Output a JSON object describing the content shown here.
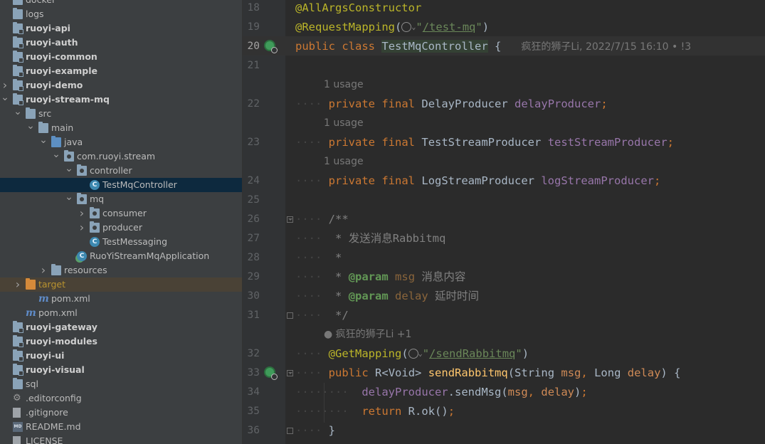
{
  "project_tree": [
    {
      "label": "docker",
      "depth": 0,
      "arrow": "none",
      "icon": "folder",
      "bold": false
    },
    {
      "label": "logs",
      "depth": 0,
      "arrow": "none",
      "icon": "folder",
      "bold": false
    },
    {
      "label": "ruoyi-api",
      "depth": 0,
      "arrow": "none",
      "icon": "module-folder",
      "bold": true
    },
    {
      "label": "ruoyi-auth",
      "depth": 0,
      "arrow": "none",
      "icon": "module-folder",
      "bold": true
    },
    {
      "label": "ruoyi-common",
      "depth": 0,
      "arrow": "none",
      "icon": "module-folder",
      "bold": true
    },
    {
      "label": "ruoyi-example",
      "depth": 0,
      "arrow": "none",
      "icon": "module-folder",
      "bold": true
    },
    {
      "label": "ruoyi-demo",
      "depth": 0,
      "arrow": "right",
      "icon": "module-folder",
      "bold": true
    },
    {
      "label": "ruoyi-stream-mq",
      "depth": 0,
      "arrow": "down",
      "icon": "module-folder",
      "bold": true
    },
    {
      "label": "src",
      "depth": 1,
      "arrow": "down",
      "icon": "folder",
      "bold": false
    },
    {
      "label": "main",
      "depth": 2,
      "arrow": "down",
      "icon": "folder",
      "bold": false
    },
    {
      "label": "java",
      "depth": 3,
      "arrow": "down",
      "icon": "source-folder",
      "bold": false
    },
    {
      "label": "com.ruoyi.stream",
      "depth": 4,
      "arrow": "down",
      "icon": "package",
      "bold": false
    },
    {
      "label": "controller",
      "depth": 5,
      "arrow": "down",
      "icon": "package",
      "bold": false
    },
    {
      "label": "TestMqController",
      "depth": 6,
      "arrow": "none",
      "icon": "class",
      "bold": false,
      "selected": true
    },
    {
      "label": "mq",
      "depth": 5,
      "arrow": "down",
      "icon": "package",
      "bold": false
    },
    {
      "label": "consumer",
      "depth": 6,
      "arrow": "right",
      "icon": "package",
      "bold": false
    },
    {
      "label": "producer",
      "depth": 6,
      "arrow": "right",
      "icon": "package",
      "bold": false
    },
    {
      "label": "TestMessaging",
      "depth": 6,
      "arrow": "none",
      "icon": "class",
      "bold": false
    },
    {
      "label": "RuoYiStreamMqApplication",
      "depth": 5,
      "arrow": "none",
      "icon": "spring-class",
      "bold": false
    },
    {
      "label": "resources",
      "depth": 3,
      "arrow": "right",
      "icon": "folder",
      "bold": false
    },
    {
      "label": "target",
      "depth": 1,
      "arrow": "right",
      "icon": "excluded-folder",
      "bold": false,
      "excluded": true
    },
    {
      "label": "pom.xml",
      "depth": 2,
      "arrow": "none",
      "icon": "maven",
      "bold": false
    },
    {
      "label": "pom.xml",
      "depth": 1,
      "arrow": "none",
      "icon": "maven",
      "bold": false
    },
    {
      "label": "ruoyi-gateway",
      "depth": 0,
      "arrow": "none",
      "icon": "module-folder",
      "bold": true
    },
    {
      "label": "ruoyi-modules",
      "depth": 0,
      "arrow": "none",
      "icon": "module-folder",
      "bold": true
    },
    {
      "label": "ruoyi-ui",
      "depth": 0,
      "arrow": "none",
      "icon": "module-folder",
      "bold": true
    },
    {
      "label": "ruoyi-visual",
      "depth": 0,
      "arrow": "none",
      "icon": "module-folder",
      "bold": true
    },
    {
      "label": "sql",
      "depth": 0,
      "arrow": "none",
      "icon": "folder",
      "bold": false
    },
    {
      "label": ".editorconfig",
      "depth": 0,
      "arrow": "none",
      "icon": "gear",
      "bold": false
    },
    {
      "label": ".gitignore",
      "depth": 0,
      "arrow": "none",
      "icon": "file",
      "bold": false
    },
    {
      "label": "README.md",
      "depth": 0,
      "arrow": "none",
      "icon": "markdown",
      "bold": false
    },
    {
      "label": "LICENSE",
      "depth": 0,
      "arrow": "none",
      "icon": "file",
      "bold": false
    }
  ],
  "editor": {
    "line_numbers": {
      "l18": "18",
      "l19": "19",
      "l20": "20",
      "l21": "21",
      "l22": "22",
      "l23": "23",
      "l24": "24",
      "l25": "25",
      "l26": "26",
      "l27": "27",
      "l28": "28",
      "l29": "29",
      "l30": "30",
      "l31": "31",
      "l32": "32",
      "l33": "33",
      "l34": "34",
      "l35": "35",
      "l36": "36"
    },
    "t": {
      "at_allargs": "@AllArgsConstructor",
      "at_reqmap": "@RequestMapping",
      "paren_open": "(",
      "paren_close": ")",
      "chev": "⌄",
      "quote": "\"",
      "path_test_mq": "/test-mq",
      "kw_public": "public",
      "kw_class": "class",
      "cls_name": "TestMqController",
      "brace_open": "{",
      "brace_close": "}",
      "blame_line20": "疯狂的狮子Li, 2022/7/15 16:10 • !3",
      "usage": "1 usage",
      "kw_private": "private",
      "kw_final": "final",
      "t_delay": "DelayProducer",
      "f_delay": "delayProducer",
      "t_test": "TestStreamProducer",
      "f_test": "testStreamProducer",
      "t_log": "LogStreamProducer",
      "f_log": "logStreamProducer",
      "semi": ";",
      "c_open": "/**",
      "c_star": "*",
      "c_desc": "发送消息Rabbitmq",
      "c_param": "@param",
      "c_msg": "msg",
      "c_msg_desc": "消息内容",
      "c_delay": "delay",
      "c_delay_desc": "延时时间",
      "c_close": "*/",
      "author_hint": "疯狂的狮子Li +1",
      "at_getmap": "@GetMapping",
      "path_send": "/sendRabbitmq",
      "t_r": "R",
      "lt": "<",
      "gt": ">",
      "t_void": "Void",
      "m_send": "sendRabbitmq",
      "t_string": "String",
      "p_msg": "msg",
      "comma": ",",
      "t_long": "Long",
      "p_delay": "delay",
      "m_sendMsg": "sendMsg",
      "dot": ".",
      "kw_return": "return",
      "m_ok": "ok",
      "ind_dots": "····"
    }
  }
}
